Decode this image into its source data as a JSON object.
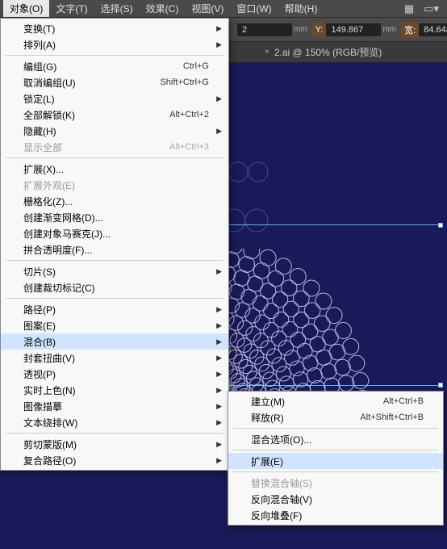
{
  "menubar": {
    "items": [
      "对象(O)",
      "文字(T)",
      "选择(S)",
      "效果(C)",
      "视图(V)",
      "窗口(W)",
      "帮助(H)"
    ]
  },
  "toolbar": {
    "x_val": "2",
    "y_label": "Y:",
    "y_val": "149.867",
    "w_label": "宽:",
    "w_val": "84.643",
    "unit": "mm"
  },
  "tab": {
    "title": "2.ai @ 150% (RGB/预览)"
  },
  "menu": {
    "items": [
      {
        "label": "变换(T)",
        "arrow": true
      },
      {
        "label": "排列(A)",
        "arrow": true
      },
      {
        "sep": true
      },
      {
        "label": "编组(G)",
        "shortcut": "Ctrl+G"
      },
      {
        "label": "取消编组(U)",
        "shortcut": "Shift+Ctrl+G"
      },
      {
        "label": "锁定(L)",
        "arrow": true
      },
      {
        "label": "全部解锁(K)",
        "shortcut": "Alt+Ctrl+2"
      },
      {
        "label": "隐藏(H)",
        "arrow": true
      },
      {
        "label": "显示全部",
        "shortcut": "Alt+Ctrl+3",
        "disabled": true
      },
      {
        "sep": true
      },
      {
        "label": "扩展(X)..."
      },
      {
        "label": "扩展外观(E)",
        "disabled": true
      },
      {
        "label": "栅格化(Z)..."
      },
      {
        "label": "创建渐变网格(D)..."
      },
      {
        "label": "创建对象马赛克(J)..."
      },
      {
        "label": "拼合透明度(F)..."
      },
      {
        "sep": true
      },
      {
        "label": "切片(S)",
        "arrow": true
      },
      {
        "label": "创建裁切标记(C)"
      },
      {
        "sep": true
      },
      {
        "label": "路径(P)",
        "arrow": true
      },
      {
        "label": "图案(E)",
        "arrow": true
      },
      {
        "label": "混合(B)",
        "arrow": true,
        "highlighted": true
      },
      {
        "label": "封套扭曲(V)",
        "arrow": true
      },
      {
        "label": "透视(P)",
        "arrow": true
      },
      {
        "label": "实时上色(N)",
        "arrow": true
      },
      {
        "label": "图像描摹",
        "arrow": true
      },
      {
        "label": "文本绕排(W)",
        "arrow": true
      },
      {
        "sep": true
      },
      {
        "label": "剪切蒙版(M)",
        "arrow": true
      },
      {
        "label": "复合路径(O)",
        "arrow": true
      }
    ]
  },
  "submenu": {
    "items": [
      {
        "label": "建立(M)",
        "shortcut": "Alt+Ctrl+B"
      },
      {
        "label": "释放(R)",
        "shortcut": "Alt+Shift+Ctrl+B"
      },
      {
        "sep": true
      },
      {
        "label": "混合选项(O)..."
      },
      {
        "sep": true
      },
      {
        "label": "扩展(E)",
        "highlighted": true
      },
      {
        "sep": true
      },
      {
        "label": "替换混合轴(S)",
        "disabled": true
      },
      {
        "label": "反向混合轴(V)"
      },
      {
        "label": "反向堆叠(F)"
      }
    ]
  }
}
